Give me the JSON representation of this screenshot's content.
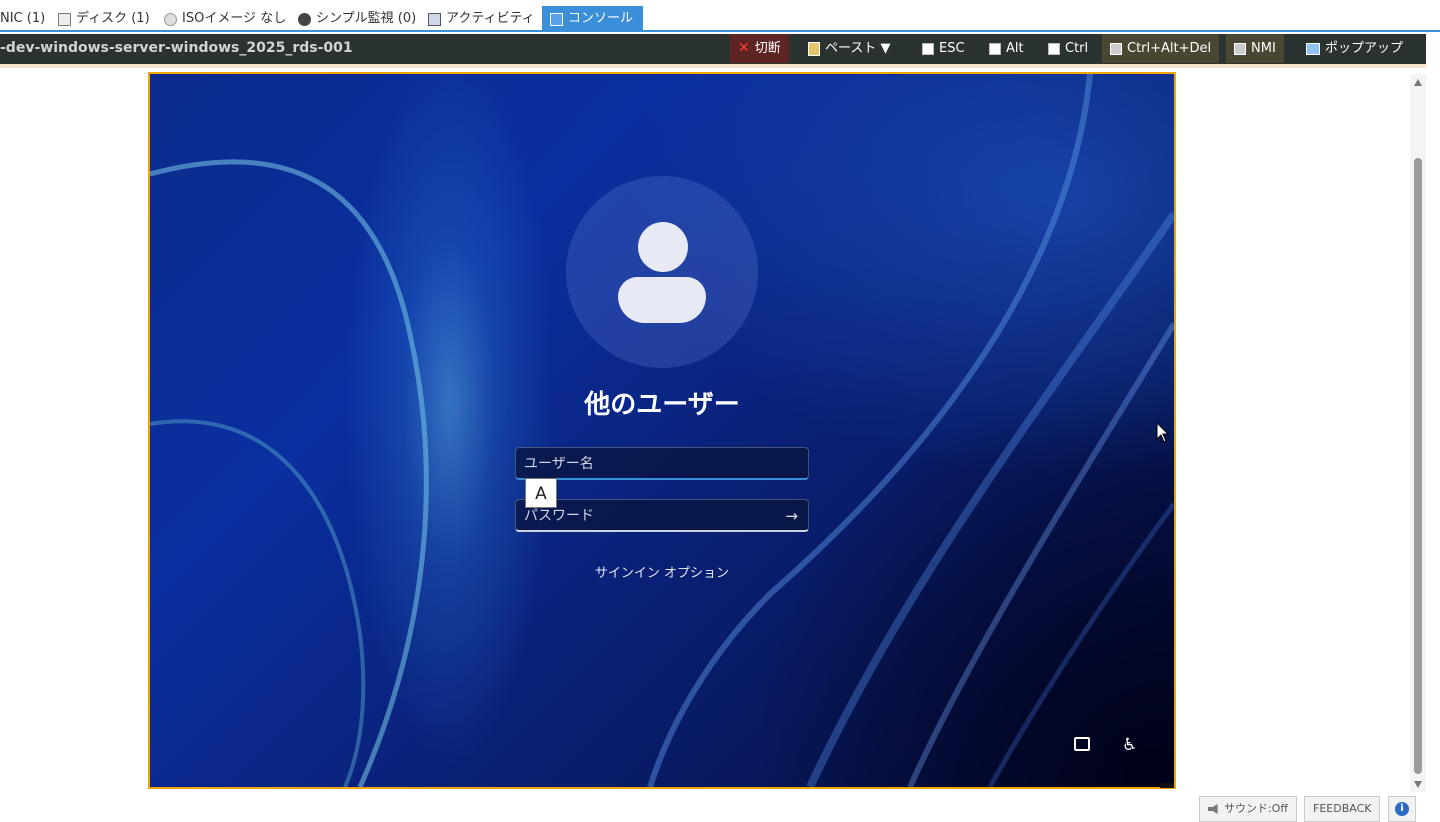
{
  "tabs": [
    {
      "label": "NIC (1)",
      "icon": "nic-icon"
    },
    {
      "label": "ディスク (1)",
      "icon": "disk-icon"
    },
    {
      "label": "ISOイメージ なし",
      "icon": "iso-icon"
    },
    {
      "label": "シンプル監視 (0)",
      "icon": "monitor-icon"
    },
    {
      "label": "アクティビティ",
      "icon": "activity-icon"
    },
    {
      "label": "コンソール",
      "icon": "console-icon",
      "active": true
    }
  ],
  "toolbar": {
    "vm_name": "-dev-windows-server-windows_2025_rds-001",
    "disconnect": "切断",
    "paste": "ペースト ▼",
    "esc": "ESC",
    "alt": "Alt",
    "ctrl": "Ctrl",
    "ctrl_alt_del": "Ctrl+Alt+Del",
    "nmi": "NMI",
    "popup": "ポップアップ"
  },
  "login": {
    "title": "他のユーザー",
    "username_placeholder": "ユーザー名",
    "password_placeholder": "パスワード",
    "ime_indicator": "A",
    "signin_options": "サインイン オプション",
    "submit_arrow": "→"
  },
  "status": {
    "sound": "サウンド:Off",
    "feedback": "FEEDBACK",
    "info": "i"
  },
  "colors": {
    "active_tab": "#3b8ed8",
    "toolbar_bg": "#2b3330",
    "console_border": "#f0a500"
  }
}
